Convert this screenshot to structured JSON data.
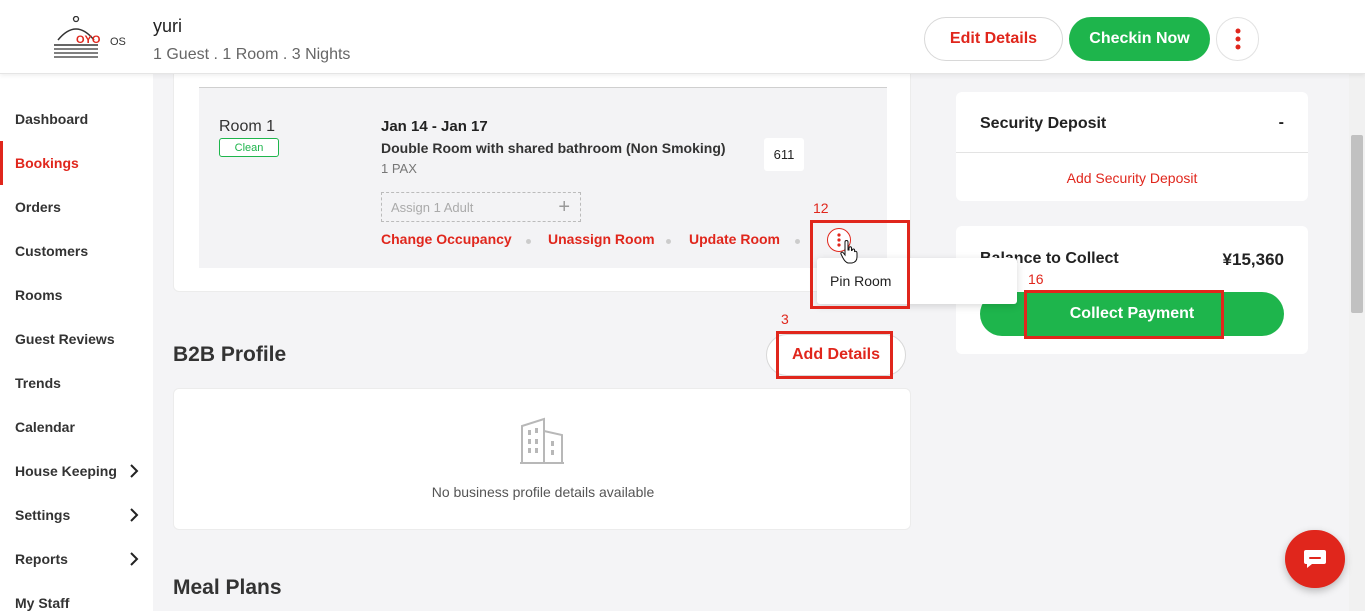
{
  "header": {
    "guest_name": "yuri",
    "guest_meta": "1 Guest . 1 Room . 3 Nights",
    "edit_label": "Edit Details",
    "checkin_label": "Checkin Now",
    "logo_text": "OYO",
    "logo_suffix": "OS"
  },
  "sidebar": {
    "items": [
      {
        "label": "Dashboard"
      },
      {
        "label": "Bookings"
      },
      {
        "label": "Orders"
      },
      {
        "label": "Customers"
      },
      {
        "label": "Rooms"
      },
      {
        "label": "Guest Reviews"
      },
      {
        "label": "Trends"
      },
      {
        "label": "Calendar"
      },
      {
        "label": "House Keeping"
      },
      {
        "label": "Settings"
      },
      {
        "label": "Reports"
      },
      {
        "label": "My Staff"
      }
    ]
  },
  "room": {
    "name": "Room 1",
    "status": "Clean",
    "dates": "Jan 14 - Jan 17",
    "type": "Double Room with shared bathroom (Non Smoking)",
    "pax": "1 PAX",
    "number": "611",
    "assign_placeholder": "Assign 1 Adult",
    "actions": [
      "Change Occupancy",
      "Unassign Room",
      "Update Room"
    ],
    "menu": [
      "Pin Room"
    ]
  },
  "b2b": {
    "title": "B2B Profile",
    "add_label": "Add Details",
    "empty_text": "No business profile details available"
  },
  "meal_plans": {
    "title": "Meal Plans"
  },
  "security_deposit": {
    "title": "Security Deposit",
    "value": "-",
    "add_label": "Add Security Deposit"
  },
  "balance": {
    "title": "Balance to Collect",
    "amount": "¥15,360",
    "collect_label": "Collect Payment"
  },
  "annotations": [
    "12",
    "3",
    "16"
  ],
  "colors": {
    "brand_red": "#e0261c",
    "green": "#1eb54c"
  }
}
